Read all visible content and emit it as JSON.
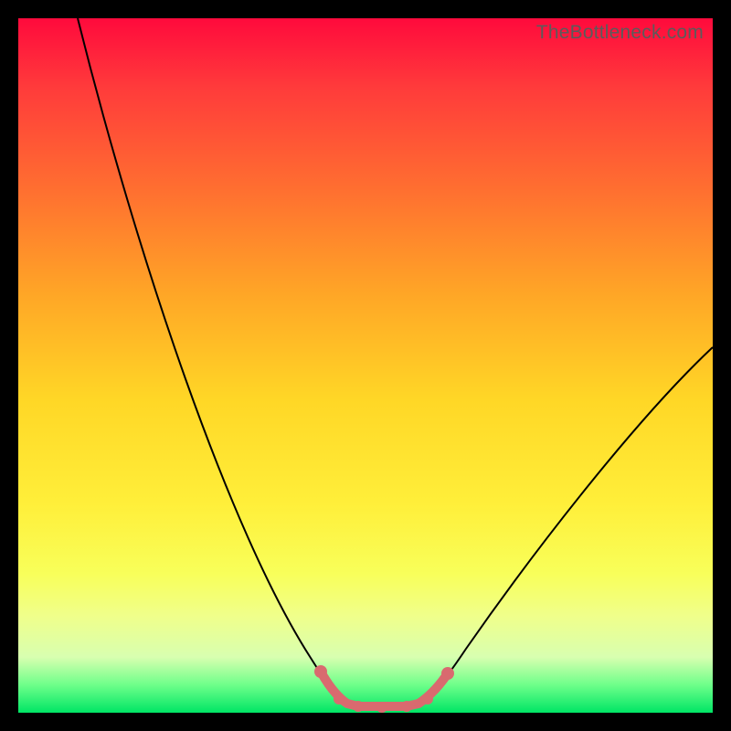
{
  "watermark": "TheBottleneck.com",
  "colors": {
    "gradient_top": "#ff0a3c",
    "gradient_bottom": "#00e565",
    "frame": "#000000",
    "curve": "#000000",
    "highlight": "#d96a6f"
  },
  "chart_data": {
    "type": "line",
    "title": "",
    "xlabel": "",
    "ylabel": "",
    "xlim": [
      0,
      100
    ],
    "ylim": [
      0,
      100
    ],
    "grid": false,
    "legend": false,
    "series": [
      {
        "name": "bottleneck-curve",
        "x": [
          8,
          15,
          25,
          35,
          42,
          46,
          49,
          52,
          56,
          60,
          65,
          75,
          90,
          100
        ],
        "values": [
          100,
          77,
          52,
          30,
          13,
          5,
          1,
          1,
          1,
          5,
          13,
          30,
          45,
          53
        ]
      },
      {
        "name": "optimal-range-highlight",
        "x": [
          44,
          46,
          49,
          52,
          56,
          59,
          62
        ],
        "values": [
          6,
          3,
          1,
          0.7,
          1,
          3,
          6
        ]
      }
    ],
    "annotations": [
      {
        "text": "TheBottleneck.com",
        "position": "top-right"
      }
    ],
    "notes": "Background is a vertical red→yellow→green gradient indicating bottleneck severity (red high, green low). Axes have no visible tick labels; values are estimated on a 0–100 normalized scale. Curve minimum (optimal match) is around x≈50–55."
  }
}
